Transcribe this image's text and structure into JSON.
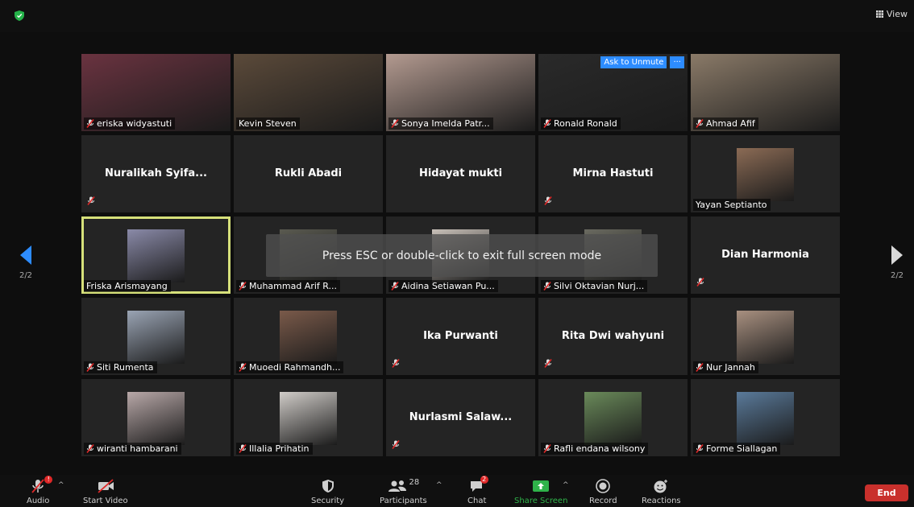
{
  "window": {
    "view_label": "View"
  },
  "overlay": {
    "message": "Press ESC or double-click to exit full screen mode"
  },
  "pagination": {
    "left": "2/2",
    "right": "2/2"
  },
  "tile_controls": {
    "ask_to_unmute": "Ask to Unmute",
    "more": "···"
  },
  "participants": [
    {
      "name": "eriska widyastuti",
      "muted": true,
      "video": true,
      "color": "#6a3340"
    },
    {
      "name": "Kevin Steven",
      "muted": false,
      "video": true,
      "color": "#5b4a3a"
    },
    {
      "name": "Sonya Imelda Patr...",
      "muted": true,
      "video": true,
      "color": "#b39a90"
    },
    {
      "name": "Ronald Ronald",
      "muted": true,
      "video": true,
      "color": "#2a2a2a"
    },
    {
      "name": "Ahmad Afif",
      "muted": true,
      "video": true,
      "color": "#8a7a68"
    },
    {
      "name": "Nuralikah  Syifa...",
      "muted": true,
      "video": false
    },
    {
      "name": "Rukli Abadi",
      "muted": false,
      "video": false
    },
    {
      "name": "Hidayat mukti",
      "muted": false,
      "video": false
    },
    {
      "name": "Mirna Hastuti",
      "muted": true,
      "video": false
    },
    {
      "name": "Yayan Septianto",
      "muted": false,
      "video": true,
      "thumb": true,
      "color": "#8b6b55"
    },
    {
      "name": "Friska Arismayang",
      "muted": false,
      "video": true,
      "thumb": true,
      "active": true,
      "color": "#8a8aa8"
    },
    {
      "name": "Muhammad Arif R...",
      "muted": true,
      "video": true,
      "thumb": true,
      "color": "#5a5a50"
    },
    {
      "name": "Aidina Setiawan Pu...",
      "muted": true,
      "video": true,
      "thumb": true,
      "color": "#c8c0b8"
    },
    {
      "name": "Silvi Oktavian Nurj...",
      "muted": true,
      "video": true,
      "thumb": true,
      "color": "#6a6a60"
    },
    {
      "name": "Dian Harmonia",
      "muted": true,
      "video": false
    },
    {
      "name": "Siti Rumenta",
      "muted": true,
      "video": true,
      "thumb": true,
      "color": "#9aa4b4"
    },
    {
      "name": "Muoedi Rahmandh...",
      "muted": true,
      "video": true,
      "thumb": true,
      "color": "#7a5a4a"
    },
    {
      "name": "Ika Purwanti",
      "muted": true,
      "video": false
    },
    {
      "name": "Rita Dwi wahyuni",
      "muted": true,
      "video": false
    },
    {
      "name": "Nur Jannah",
      "muted": true,
      "video": true,
      "thumb": true,
      "color": "#a89080"
    },
    {
      "name": "wiranti hambarani",
      "muted": true,
      "video": true,
      "thumb": true,
      "color": "#b8a8a8"
    },
    {
      "name": "Illalia Prihatin",
      "muted": true,
      "video": true,
      "thumb": true,
      "color": "#d0ccc8"
    },
    {
      "name": "Nurlasmi  Salaw...",
      "muted": true,
      "video": false
    },
    {
      "name": "Rafli endana wilsony",
      "muted": true,
      "video": true,
      "thumb": true,
      "color": "#6a8a5a"
    },
    {
      "name": "Forme Siallagan",
      "muted": true,
      "video": true,
      "thumb": true,
      "color": "#5a7a9a"
    }
  ],
  "toolbar": {
    "audio": "Audio",
    "start_video": "Start Video",
    "security": "Security",
    "participants": "Participants",
    "participants_count": "28",
    "chat": "Chat",
    "chat_badge": "2",
    "share_screen": "Share Screen",
    "record": "Record",
    "reactions": "Reactions",
    "end": "End",
    "audio_badge": "!"
  },
  "colors": {
    "share_green": "#2fb34a",
    "end_red": "#c9302c",
    "active_outline": "#d6e07a",
    "ask_blue": "#2d8cff"
  }
}
